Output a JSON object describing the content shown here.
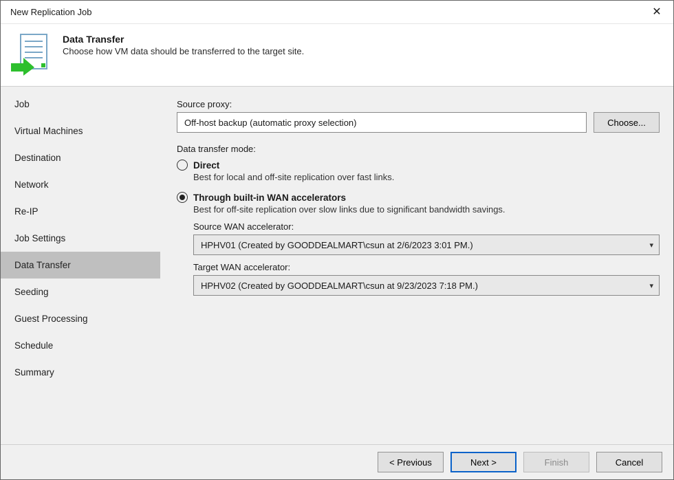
{
  "window": {
    "title": "New Replication Job"
  },
  "header": {
    "title": "Data Transfer",
    "subtitle": "Choose how VM data should be transferred to the target site."
  },
  "sidebar": {
    "items": [
      {
        "label": "Job"
      },
      {
        "label": "Virtual Machines"
      },
      {
        "label": "Destination"
      },
      {
        "label": "Network"
      },
      {
        "label": "Re-IP"
      },
      {
        "label": "Job Settings"
      },
      {
        "label": "Data Transfer",
        "active": true
      },
      {
        "label": "Seeding"
      },
      {
        "label": "Guest Processing"
      },
      {
        "label": "Schedule"
      },
      {
        "label": "Summary"
      }
    ]
  },
  "content": {
    "source_proxy_label": "Source proxy:",
    "source_proxy_value": "Off-host backup (automatic proxy selection)",
    "choose_button": "Choose...",
    "mode_label": "Data transfer mode:",
    "direct": {
      "title": "Direct",
      "desc": "Best for local and off-site replication over fast links.",
      "selected": false
    },
    "wan": {
      "title": "Through built-in WAN accelerators",
      "desc": "Best for off-site replication over slow links due to significant bandwidth savings.",
      "selected": true,
      "source_label": "Source WAN accelerator:",
      "source_value": "HPHV01 (Created by GOODDEALMART\\csun at 2/6/2023 3:01 PM.)",
      "target_label": "Target WAN accelerator:",
      "target_value": "HPHV02 (Created by GOODDEALMART\\csun at 9/23/2023 7:18 PM.)"
    }
  },
  "footer": {
    "previous": "< Previous",
    "next": "Next >",
    "finish": "Finish",
    "cancel": "Cancel"
  }
}
